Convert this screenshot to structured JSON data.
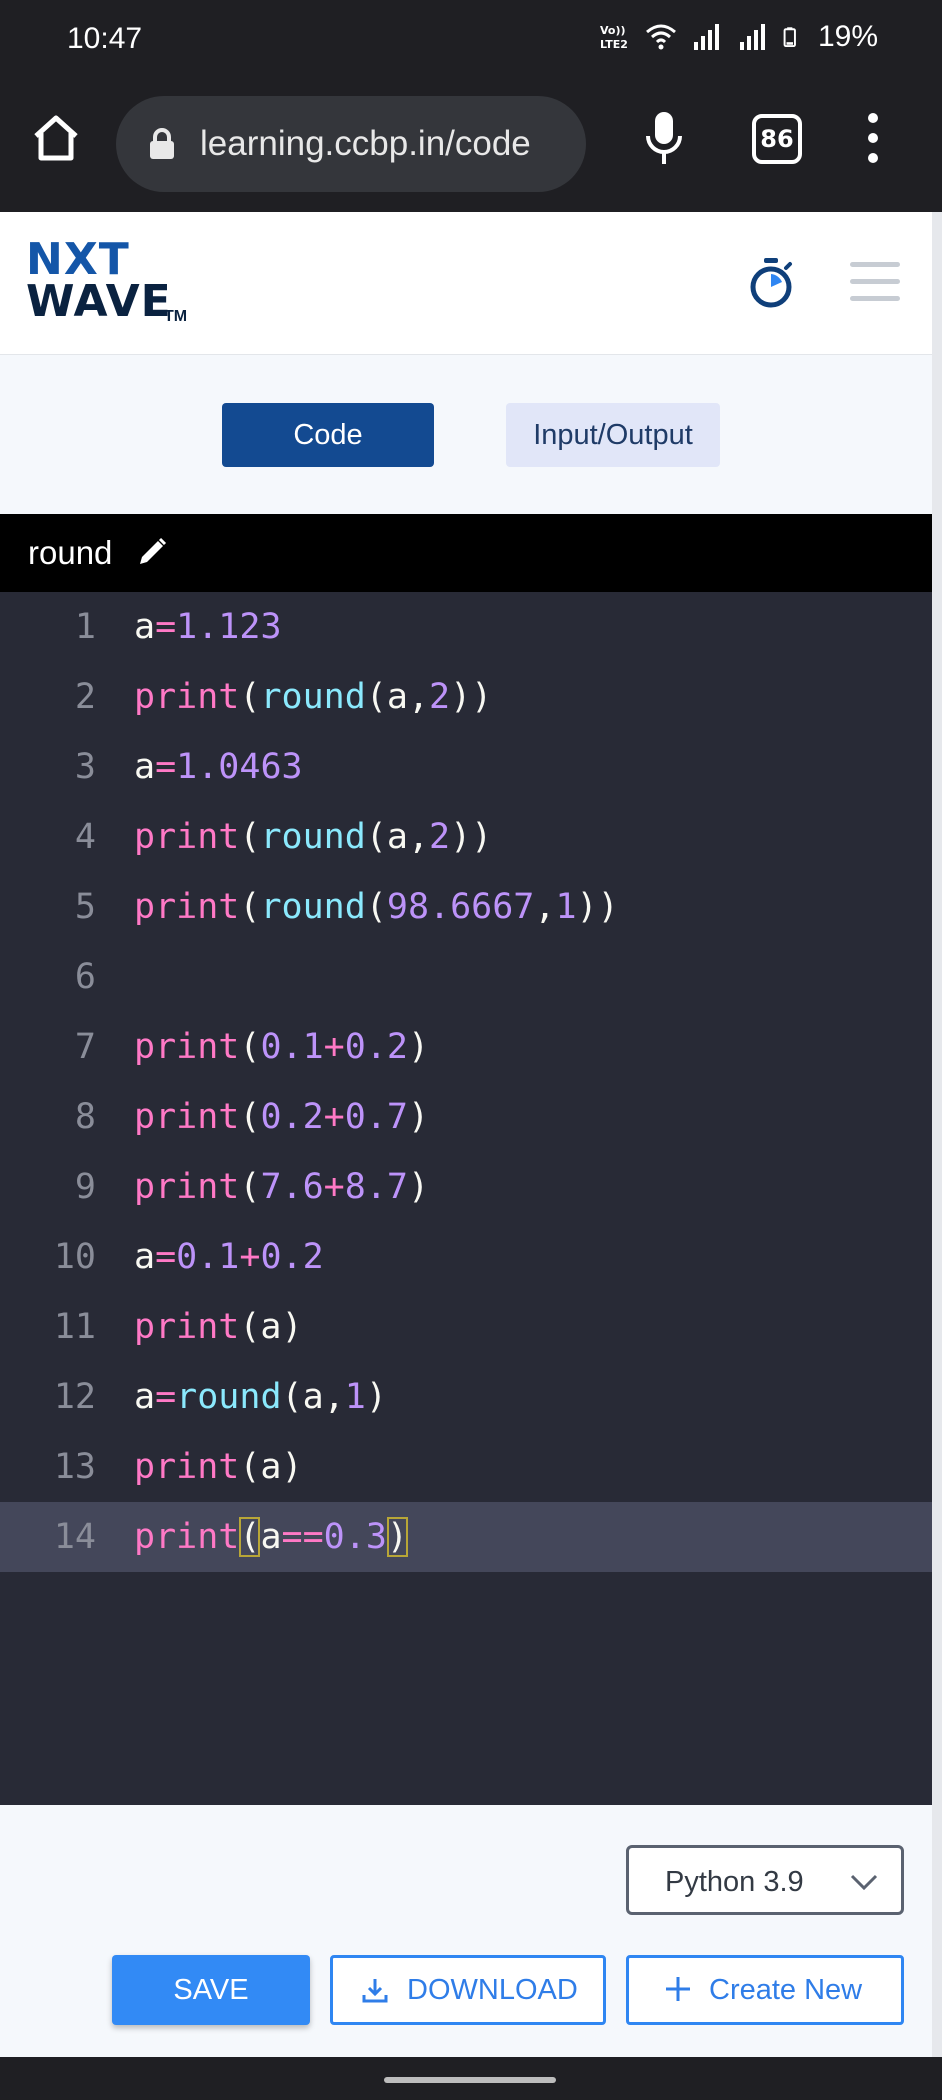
{
  "status_bar": {
    "time": "10:47",
    "battery": "19%",
    "icons": [
      "volte-lte2-icon",
      "wifi-icon",
      "signal-icon",
      "signal-icon",
      "battery-icon"
    ]
  },
  "browser": {
    "url": "learning.ccbp.in/code",
    "tab_count": "86",
    "icons": [
      "home-icon",
      "lock-icon",
      "mic-icon",
      "tabs-icon",
      "more-vert-icon"
    ]
  },
  "header": {
    "logo_line1": "NXT",
    "logo_line2": "WAVE",
    "logo_tm": "TM",
    "icons": [
      "timer-icon",
      "hamburger-icon"
    ]
  },
  "tabs": [
    {
      "label": "Code",
      "active": true
    },
    {
      "label": "Input/Output",
      "active": false
    }
  ],
  "file": {
    "name": "round"
  },
  "editor": {
    "active_line": 14,
    "lines": [
      {
        "number": "1",
        "tokens": [
          {
            "t": "a",
            "c": "v"
          },
          {
            "t": "=",
            "c": "o"
          },
          {
            "t": "1.123",
            "c": "n"
          }
        ]
      },
      {
        "number": "2",
        "tokens": [
          {
            "t": "print",
            "c": "k"
          },
          {
            "t": "(",
            "c": "p"
          },
          {
            "t": "round",
            "c": "f"
          },
          {
            "t": "(a,",
            "c": "p"
          },
          {
            "t": "2",
            "c": "n"
          },
          {
            "t": "))",
            "c": "p"
          }
        ]
      },
      {
        "number": "3",
        "tokens": [
          {
            "t": "a",
            "c": "v"
          },
          {
            "t": "=",
            "c": "o"
          },
          {
            "t": "1.0463",
            "c": "n"
          }
        ]
      },
      {
        "number": "4",
        "tokens": [
          {
            "t": "print",
            "c": "k"
          },
          {
            "t": "(",
            "c": "p"
          },
          {
            "t": "round",
            "c": "f"
          },
          {
            "t": "(a,",
            "c": "p"
          },
          {
            "t": "2",
            "c": "n"
          },
          {
            "t": "))",
            "c": "p"
          }
        ]
      },
      {
        "number": "5",
        "tokens": [
          {
            "t": "print",
            "c": "k"
          },
          {
            "t": "(",
            "c": "p"
          },
          {
            "t": "round",
            "c": "f"
          },
          {
            "t": "(",
            "c": "p"
          },
          {
            "t": "98.6667",
            "c": "n"
          },
          {
            "t": ",",
            "c": "p"
          },
          {
            "t": "1",
            "c": "n"
          },
          {
            "t": "))",
            "c": "p"
          }
        ]
      },
      {
        "number": "6",
        "tokens": []
      },
      {
        "number": "7",
        "tokens": [
          {
            "t": "print",
            "c": "k"
          },
          {
            "t": "(",
            "c": "p"
          },
          {
            "t": "0.1",
            "c": "n"
          },
          {
            "t": "+",
            "c": "o"
          },
          {
            "t": "0.2",
            "c": "n"
          },
          {
            "t": ")",
            "c": "p"
          }
        ]
      },
      {
        "number": "8",
        "tokens": [
          {
            "t": "print",
            "c": "k"
          },
          {
            "t": "(",
            "c": "p"
          },
          {
            "t": "0.2",
            "c": "n"
          },
          {
            "t": "+",
            "c": "o"
          },
          {
            "t": "0.7",
            "c": "n"
          },
          {
            "t": ")",
            "c": "p"
          }
        ]
      },
      {
        "number": "9",
        "tokens": [
          {
            "t": "print",
            "c": "k"
          },
          {
            "t": "(",
            "c": "p"
          },
          {
            "t": "7.6",
            "c": "n"
          },
          {
            "t": "+",
            "c": "o"
          },
          {
            "t": "8.7",
            "c": "n"
          },
          {
            "t": ")",
            "c": "p"
          }
        ]
      },
      {
        "number": "10",
        "tokens": [
          {
            "t": "a",
            "c": "v"
          },
          {
            "t": "=",
            "c": "o"
          },
          {
            "t": "0.1",
            "c": "n"
          },
          {
            "t": "+",
            "c": "o"
          },
          {
            "t": "0.2",
            "c": "n"
          }
        ]
      },
      {
        "number": "11",
        "tokens": [
          {
            "t": "print",
            "c": "k"
          },
          {
            "t": "(a)",
            "c": "p"
          }
        ]
      },
      {
        "number": "12",
        "tokens": [
          {
            "t": "a",
            "c": "v"
          },
          {
            "t": "=",
            "c": "o"
          },
          {
            "t": "round",
            "c": "f"
          },
          {
            "t": "(a,",
            "c": "p"
          },
          {
            "t": "1",
            "c": "n"
          },
          {
            "t": ")",
            "c": "p"
          }
        ]
      },
      {
        "number": "13",
        "tokens": [
          {
            "t": "print",
            "c": "k"
          },
          {
            "t": "(a)",
            "c": "p"
          }
        ]
      },
      {
        "number": "14",
        "tokens": [
          {
            "t": "print",
            "c": "k"
          },
          {
            "t": "(",
            "c": "p",
            "m": true
          },
          {
            "t": "a",
            "c": "v"
          },
          {
            "t": "==",
            "c": "o"
          },
          {
            "t": "0.3",
            "c": "n"
          },
          {
            "t": ")",
            "c": "p",
            "m": true
          }
        ]
      }
    ]
  },
  "footer": {
    "language": "Python 3.9",
    "save_label": "SAVE",
    "download_label": "DOWNLOAD",
    "create_label": "Create New"
  },
  "colors": {
    "editor_bg": "#282a36",
    "active_line_bg": "#44475a",
    "keyword": "#ff79c6",
    "function": "#8be9fd",
    "number": "#bd93f9",
    "primary_button": "#328af5",
    "active_tab": "#134a91"
  }
}
